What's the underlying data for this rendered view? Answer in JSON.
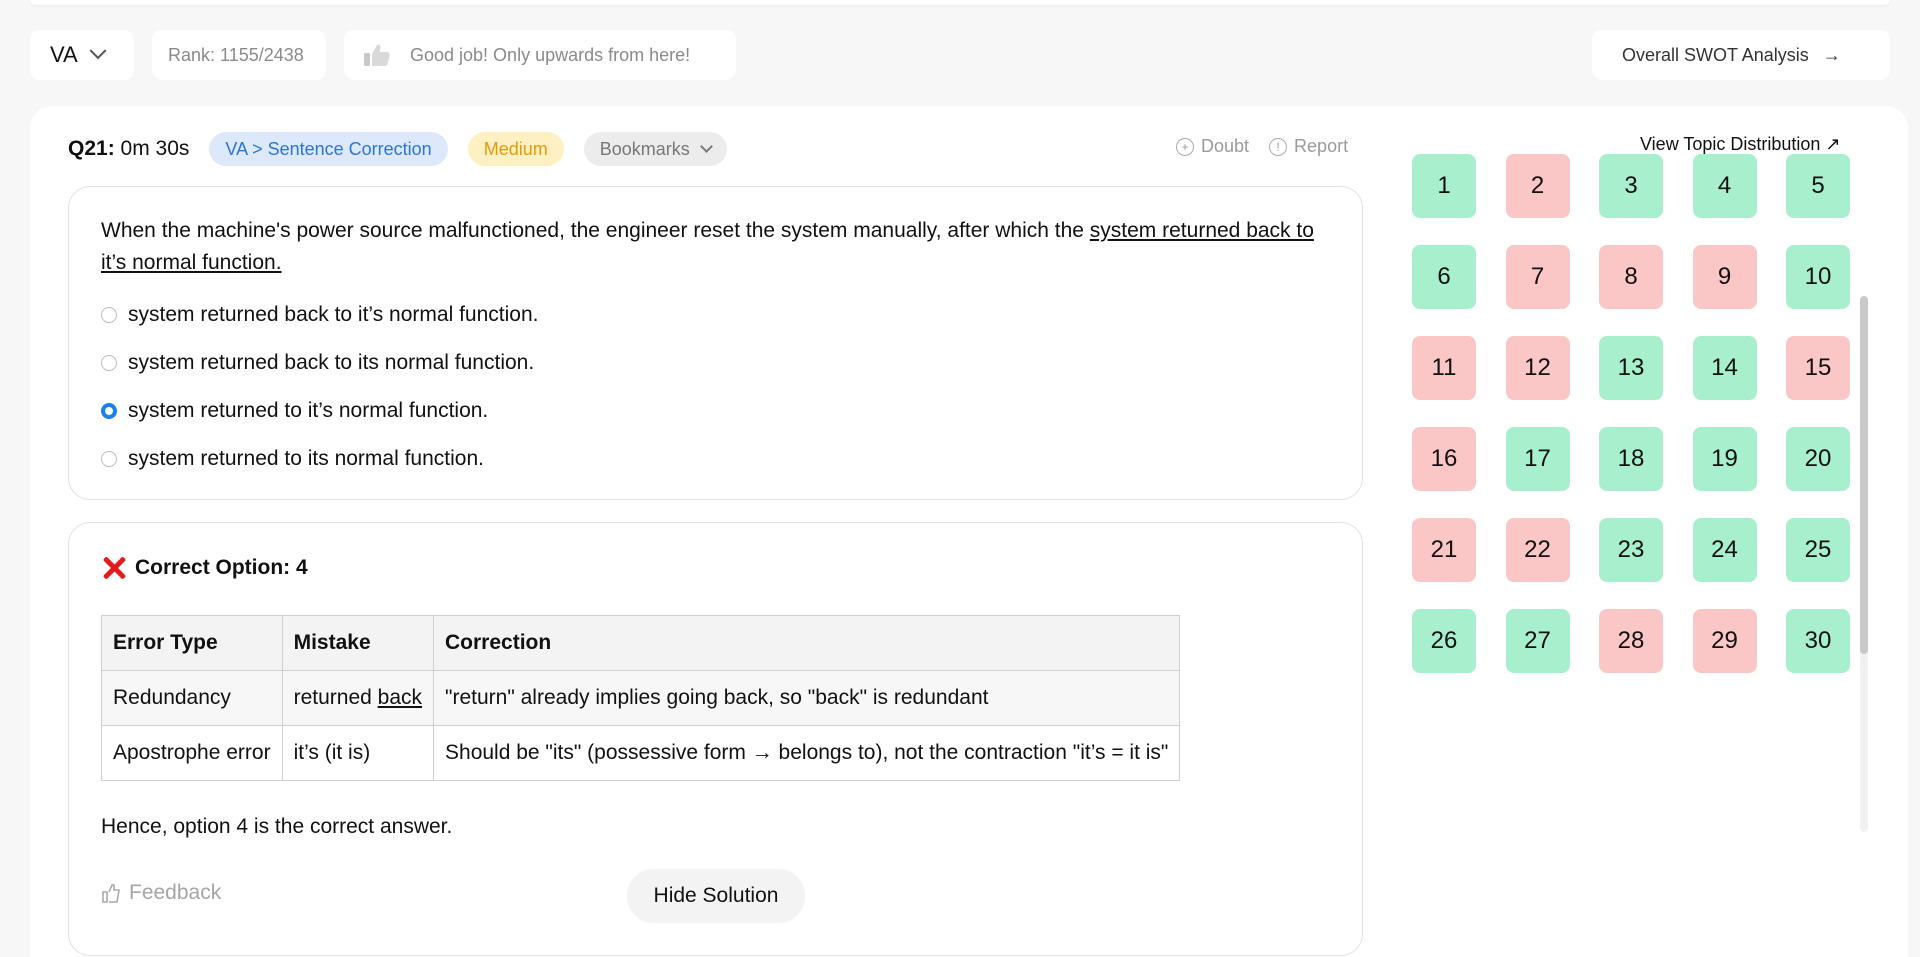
{
  "topbar": {
    "section": "VA",
    "rank": "Rank: 1155/2438",
    "message": "Good job! Only upwards from here!",
    "swot": "Overall SWOT Analysis",
    "swot_arrow": "→"
  },
  "question": {
    "label": "Q21:",
    "time": "0m 30s",
    "topic": "VA > Sentence Correction",
    "difficulty": "Medium",
    "bookmarks": "Bookmarks",
    "doubt": "Doubt",
    "report": "Report",
    "topic_distribution": "View Topic Distribution ↗",
    "text_before": "When the machine's power source malfunctioned, the engineer reset the system manually, after which the ",
    "text_underlined": "system returned back to it’s normal function.",
    "options": [
      {
        "text": "system returned back to it’s normal function.",
        "selected": false
      },
      {
        "text": "system returned back to its normal function.",
        "selected": false
      },
      {
        "text": "system returned to it’s normal function.",
        "selected": true
      },
      {
        "text": "system returned to its normal function.",
        "selected": false
      }
    ]
  },
  "solution": {
    "correct_label": "Correct Option: 4",
    "table": {
      "headers": [
        "Error Type",
        "Mistake",
        "Correction"
      ],
      "rows": [
        {
          "type": "Redundancy",
          "mistake_prefix": "returned ",
          "mistake_underlined": "back",
          "correction": "\"return\" already implies going back, so \"back\" is redundant"
        },
        {
          "type": "Apostrophe error",
          "mistake_prefix": "it’s (it is)",
          "mistake_underlined": "",
          "correction": "Should be \"its\" (possessive form → belongs to), not the contraction \"it’s = it is\""
        }
      ]
    },
    "conclusion": "Hence, option 4 is the correct answer.",
    "feedback": "Feedback",
    "hide_button": "Hide Solution"
  },
  "question_grid": [
    {
      "n": "1",
      "status": "correct"
    },
    {
      "n": "2",
      "status": "wrong"
    },
    {
      "n": "3",
      "status": "correct"
    },
    {
      "n": "4",
      "status": "correct"
    },
    {
      "n": "5",
      "status": "correct"
    },
    {
      "n": "6",
      "status": "correct"
    },
    {
      "n": "7",
      "status": "wrong"
    },
    {
      "n": "8",
      "status": "wrong"
    },
    {
      "n": "9",
      "status": "wrong"
    },
    {
      "n": "10",
      "status": "correct"
    },
    {
      "n": "11",
      "status": "wrong"
    },
    {
      "n": "12",
      "status": "wrong"
    },
    {
      "n": "13",
      "status": "correct"
    },
    {
      "n": "14",
      "status": "correct"
    },
    {
      "n": "15",
      "status": "wrong"
    },
    {
      "n": "16",
      "status": "wrong"
    },
    {
      "n": "17",
      "status": "correct"
    },
    {
      "n": "18",
      "status": "correct"
    },
    {
      "n": "19",
      "status": "correct"
    },
    {
      "n": "20",
      "status": "correct"
    },
    {
      "n": "21",
      "status": "wrong"
    },
    {
      "n": "22",
      "status": "wrong"
    },
    {
      "n": "23",
      "status": "correct"
    },
    {
      "n": "24",
      "status": "correct"
    },
    {
      "n": "25",
      "status": "correct"
    },
    {
      "n": "26",
      "status": "correct"
    },
    {
      "n": "27",
      "status": "correct"
    },
    {
      "n": "28",
      "status": "wrong"
    },
    {
      "n": "29",
      "status": "wrong"
    },
    {
      "n": "30",
      "status": "correct"
    }
  ],
  "colors": {
    "correct": "#a8f0cd",
    "wrong": "#fbc6c6",
    "accent": "#1a7ff0",
    "topic_tag": "#dde9fb",
    "difficulty_tag": "#fdf0c2"
  },
  "icons": {
    "thumb": "thumbs-up-icon",
    "doubt": "plus-circle-icon",
    "report": "info-circle-icon",
    "feedback": "thumbs-feedback-icon",
    "wrong": "cross-icon"
  }
}
